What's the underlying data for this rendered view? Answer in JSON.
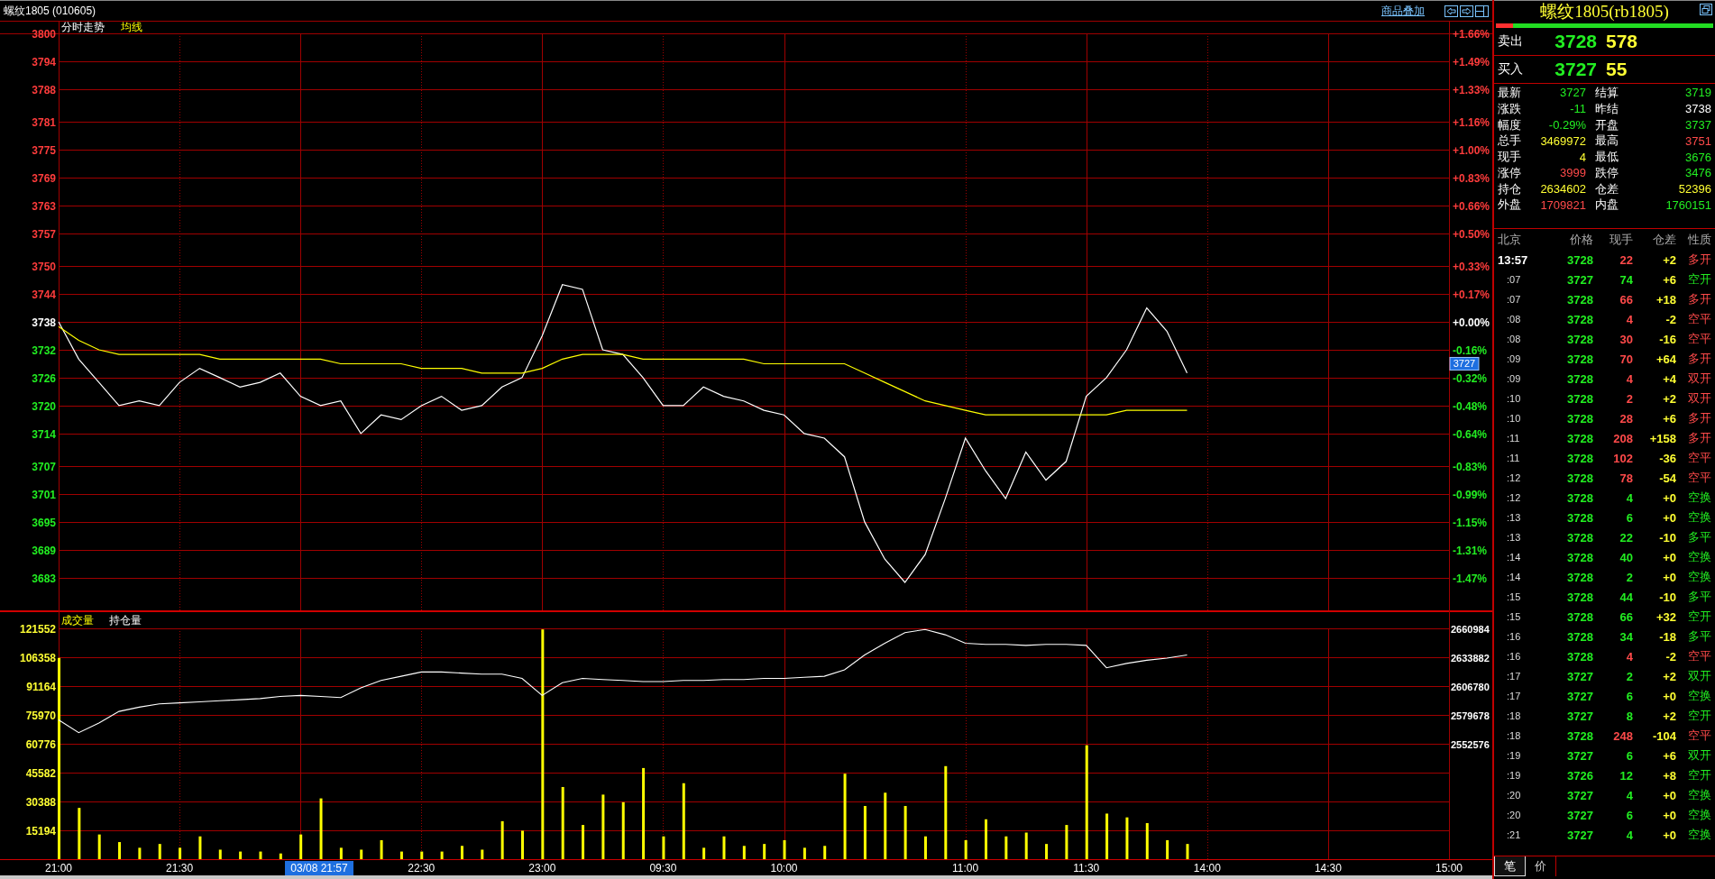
{
  "window": {
    "title": "螺纹1805 (010605)"
  },
  "toolbar": {
    "overlay_link": "商品叠加"
  },
  "price_chart": {
    "axis_labels": [
      {
        "color": "#ff3c3c"
      },
      {
        "color": "#ff3c3c"
      },
      {
        "color": "#ff3c3c"
      },
      {
        "color": "#ff3c3c"
      },
      {
        "color": "#ff3c3c"
      },
      {
        "color": "#ff3c3c"
      },
      {
        "color": "#ff3c3c"
      },
      {
        "color": "#ff3c3c"
      },
      {
        "color": "#ff3c3c"
      },
      {
        "color": "#ff3c3c"
      },
      {
        "color": "#ffffff"
      },
      {
        "color": "#22ee22"
      },
      {
        "color": "#22ee22"
      },
      {
        "color": "#22ee22"
      },
      {
        "color": "#22ee22"
      },
      {
        "color": "#22ee22"
      },
      {
        "color": "#22ee22"
      },
      {
        "color": "#22ee22"
      },
      {
        "color": "#22ee22"
      },
      {
        "color": "#22ee22"
      }
    ],
    "last_price_tag": "3727",
    "chart_data": {
      "type": "line",
      "title": "分时走势",
      "grid": true,
      "ylim": [
        3676,
        3800
      ],
      "yticks": [
        3800,
        3794,
        3788,
        3781,
        3775,
        3769,
        3763,
        3757,
        3750,
        3744,
        3738,
        3732,
        3726,
        3720,
        3714,
        3707,
        3701,
        3695,
        3689,
        3683
      ],
      "y2ticks": [
        "+1.66%",
        "+1.49%",
        "+1.33%",
        "+1.16%",
        "+1.00%",
        "+0.83%",
        "+0.66%",
        "+0.50%",
        "+0.33%",
        "+0.17%",
        "+0.00%",
        "-0.16%",
        "-0.32%",
        "-0.48%",
        "-0.64%",
        "-0.83%",
        "-0.99%",
        "-1.15%",
        "-1.31%",
        "-1.47%"
      ],
      "categories": [
        null,
        null,
        null,
        null,
        null,
        null,
        null,
        null,
        null,
        null,
        null,
        null,
        null,
        null,
        null,
        null,
        null,
        null,
        null,
        null,
        null,
        null,
        null,
        null,
        null,
        null,
        null,
        null,
        null,
        null,
        null,
        null,
        null,
        null,
        null,
        null,
        null,
        null,
        null,
        null,
        null,
        null,
        null,
        null,
        null,
        null,
        null,
        null,
        null,
        null,
        null,
        null,
        null,
        null,
        null,
        null,
        null,
        null,
        null,
        null,
        null,
        null,
        null,
        null,
        null,
        null,
        null,
        null,
        null,
        null
      ],
      "series": [
        {
          "color": "#ffffff",
          "values": [
            3738,
            3730,
            3725,
            3720,
            3721,
            3720,
            3725,
            3728,
            3726,
            3724,
            3725,
            3727,
            3722,
            3720,
            3721,
            3714,
            3718,
            3717,
            3720,
            3722,
            3719,
            3720,
            3724,
            3726,
            3735,
            3746,
            3745,
            3732,
            3731,
            3726,
            3720,
            3720,
            3724,
            3722,
            3721,
            3719,
            3718,
            3714,
            3713,
            3709,
            3695,
            3687,
            3682,
            3688,
            3700,
            3713,
            3706,
            3700,
            3710,
            3704,
            3708,
            3722,
            3726,
            3732,
            3741,
            3736,
            3727,
            null,
            null,
            null,
            null,
            null,
            null,
            null,
            null,
            null,
            null,
            null,
            null,
            null
          ]
        },
        {
          "name": "均线",
          "color": "#ffff00",
          "values": [
            3737,
            3734,
            3732,
            3731,
            3731,
            3731,
            3731,
            3731,
            3730,
            3730,
            3730,
            3730,
            3730,
            3730,
            3729,
            3729,
            3729,
            3729,
            3728,
            3728,
            3728,
            3727,
            3727,
            3727,
            3728,
            3730,
            3731,
            3731,
            3731,
            3730,
            3730,
            3730,
            3730,
            3730,
            3730,
            3729,
            3729,
            3729,
            3729,
            3729,
            3727,
            3725,
            3723,
            3721,
            3720,
            3719,
            3718,
            3718,
            3718,
            3718,
            3718,
            3718,
            3718,
            3719,
            3719,
            3719,
            3719,
            null,
            null,
            null,
            null,
            null,
            null,
            null,
            null,
            null,
            null,
            null,
            null,
            null
          ]
        }
      ]
    }
  },
  "volume_chart": {
    "cursor_label": "03/08 21:57",
    "chart_data": {
      "type": "bar",
      "grid": true,
      "ylim": [
        0,
        121552
      ],
      "yticks": [
        121552,
        106358,
        91164,
        75970,
        60776,
        45582,
        30388,
        15194
      ],
      "categories": [
        "21:00",
        null,
        null,
        null,
        null,
        null,
        "21:30",
        null,
        null,
        null,
        null,
        null,
        null,
        null,
        null,
        null,
        null,
        null,
        "22:30",
        null,
        null,
        null,
        null,
        null,
        "23:00",
        null,
        null,
        null,
        null,
        null,
        "09:30",
        null,
        null,
        null,
        null,
        null,
        "10:00",
        null,
        null,
        null,
        null,
        null,
        null,
        null,
        null,
        "11:00",
        null,
        null,
        null,
        null,
        null,
        "11:30",
        null,
        null,
        null,
        null,
        null,
        "14:00",
        null,
        null,
        null,
        null,
        null,
        "14:30",
        null,
        null,
        null,
        null,
        null,
        "15:00"
      ],
      "series": [
        {
          "name": "成交量",
          "color": "#ffff00",
          "values": [
            106000,
            27000,
            13000,
            9000,
            6000,
            8000,
            6000,
            12000,
            5000,
            4000,
            4000,
            3000,
            13000,
            32000,
            6000,
            5000,
            10000,
            4000,
            4000,
            4000,
            7000,
            5000,
            20000,
            15000,
            121000,
            38000,
            18000,
            34000,
            30000,
            48000,
            12000,
            40000,
            6000,
            12000,
            7000,
            8000,
            10000,
            6000,
            7000,
            45000,
            28000,
            35000,
            28000,
            12000,
            49000,
            10000,
            21000,
            12000,
            14000,
            8000,
            18000,
            60000,
            24000,
            22000,
            19000,
            10000,
            8000,
            null,
            null,
            null,
            null,
            null,
            null,
            null,
            null,
            null,
            null,
            null,
            null,
            null
          ]
        }
      ]
    },
    "open_interest": {
      "chart_data": {
        "type": "line",
        "ylim": [
          2552576,
          2660984
        ],
        "yticks": [
          2660984,
          2633882,
          2606780,
          2579678,
          2552576
        ],
        "categories": [
          null,
          null,
          null,
          null,
          null,
          null,
          null,
          null,
          null,
          null,
          null,
          null,
          null,
          null,
          null,
          null,
          null,
          null,
          null,
          null,
          null,
          null,
          null,
          null,
          null,
          null,
          null,
          null,
          null,
          null,
          null,
          null,
          null,
          null,
          null,
          null,
          null,
          null,
          null,
          null,
          null,
          null,
          null,
          null,
          null,
          null,
          null,
          null,
          null,
          null,
          null,
          null,
          null,
          null,
          null,
          null,
          null,
          null,
          null,
          null,
          null,
          null,
          null,
          null,
          null,
          null,
          null,
          null,
          null,
          null
        ],
        "series": [
          {
            "name": "持仓量",
            "color": "#ffffff",
            "values": [
              2575000,
              2563000,
              2572000,
              2583000,
              2587000,
              2590000,
              2591000,
              2592000,
              2593000,
              2594000,
              2595000,
              2597000,
              2598000,
              2597000,
              2596000,
              2605000,
              2612000,
              2616000,
              2620000,
              2620000,
              2619000,
              2618000,
              2618000,
              2614000,
              2598000,
              2610000,
              2614000,
              2613000,
              2612000,
              2611000,
              2611000,
              2612000,
              2612000,
              2613000,
              2613000,
              2614000,
              2614000,
              2615000,
              2616000,
              2622000,
              2636000,
              2647000,
              2657000,
              2660000,
              2655000,
              2647000,
              2646000,
              2646000,
              2645000,
              2646000,
              2646000,
              2645000,
              2624000,
              2628000,
              2631000,
              2633000,
              2636000,
              null,
              null,
              null,
              null,
              null,
              null,
              null,
              null,
              null,
              null,
              null,
              null,
              null
            ]
          }
        ]
      }
    }
  },
  "quote": {
    "title": "螺纹1805(rb1805)",
    "ratio_bar": {
      "level": 0.08
    },
    "ask": {
      "label": "卖出",
      "price": "3728",
      "volume": "578"
    },
    "bid": {
      "label": "买入",
      "price": "3727",
      "volume": "55"
    },
    "stats": [
      {
        "label": "最新",
        "value": "3727",
        "color": "#22ee22"
      },
      {
        "label": "结算",
        "value": "3719",
        "color": "#22ee22"
      },
      {
        "label": "涨跌",
        "value": "-11",
        "color": "#22ee22"
      },
      {
        "label": "昨结",
        "value": "3738",
        "color": "#ffffff"
      },
      {
        "label": "幅度",
        "value": "-0.29%",
        "color": "#22ee22"
      },
      {
        "label": "开盘",
        "value": "3737",
        "color": "#22ee22"
      },
      {
        "label": "总手",
        "value": "3469972",
        "color": "#ffff33"
      },
      {
        "label": "最高",
        "value": "3751",
        "color": "#ff4a4a"
      },
      {
        "label": "现手",
        "value": "4",
        "color": "#ffff33"
      },
      {
        "label": "最低",
        "value": "3676",
        "color": "#22ee22"
      },
      {
        "label": "涨停",
        "value": "3999",
        "color": "#ff4a4a"
      },
      {
        "label": "跌停",
        "value": "3476",
        "color": "#22ee22"
      },
      {
        "label": "持仓",
        "value": "2634602",
        "color": "#ffff33"
      },
      {
        "label": "仓差",
        "value": "52396",
        "color": "#ffff33"
      },
      {
        "label": "外盘",
        "value": "1709821",
        "color": "#ff4a4a"
      },
      {
        "label": "内盘",
        "value": "1760151",
        "color": "#22ee22"
      }
    ]
  },
  "trades": {
    "columns": [
      "北京",
      "价格",
      "现手",
      "仓差",
      "性质"
    ],
    "rows": [
      {
        "time": "13:57",
        "price": "3728",
        "volume": "22",
        "change": "+2",
        "nature": "多开",
        "active_buy": true
      },
      {
        "time": ":07",
        "price": "3727",
        "volume": "74",
        "change": "+6",
        "nature": "空开",
        "active_buy": false
      },
      {
        "time": ":07",
        "price": "3728",
        "volume": "66",
        "change": "+18",
        "nature": "多开",
        "active_buy": true
      },
      {
        "time": ":08",
        "price": "3728",
        "volume": "4",
        "change": "-2",
        "nature": "空平",
        "active_buy": true
      },
      {
        "time": ":08",
        "price": "3728",
        "volume": "30",
        "change": "-16",
        "nature": "空平",
        "active_buy": true
      },
      {
        "time": ":09",
        "price": "3728",
        "volume": "70",
        "change": "+64",
        "nature": "多开",
        "active_buy": true
      },
      {
        "time": ":09",
        "price": "3728",
        "volume": "4",
        "change": "+4",
        "nature": "双开",
        "active_buy": true
      },
      {
        "time": ":10",
        "price": "3728",
        "volume": "2",
        "change": "+2",
        "nature": "双开",
        "active_buy": true
      },
      {
        "time": ":10",
        "price": "3728",
        "volume": "28",
        "change": "+6",
        "nature": "多开",
        "active_buy": true
      },
      {
        "time": ":11",
        "price": "3728",
        "volume": "208",
        "change": "+158",
        "nature": "多开",
        "active_buy": true
      },
      {
        "time": ":11",
        "price": "3728",
        "volume": "102",
        "change": "-36",
        "nature": "空平",
        "active_buy": true
      },
      {
        "time": ":12",
        "price": "3728",
        "volume": "78",
        "change": "-54",
        "nature": "空平",
        "active_buy": true
      },
      {
        "time": ":12",
        "price": "3728",
        "volume": "4",
        "change": "+0",
        "nature": "空换",
        "active_buy": false
      },
      {
        "time": ":13",
        "price": "3728",
        "volume": "6",
        "change": "+0",
        "nature": "空换",
        "active_buy": false
      },
      {
        "time": ":13",
        "price": "3728",
        "volume": "22",
        "change": "-10",
        "nature": "多平",
        "active_buy": false
      },
      {
        "time": ":14",
        "price": "3728",
        "volume": "40",
        "change": "+0",
        "nature": "空换",
        "active_buy": false
      },
      {
        "time": ":14",
        "price": "3728",
        "volume": "2",
        "change": "+0",
        "nature": "空换",
        "active_buy": false
      },
      {
        "time": ":15",
        "price": "3728",
        "volume": "44",
        "change": "-10",
        "nature": "多平",
        "active_buy": false
      },
      {
        "time": ":15",
        "price": "3728",
        "volume": "66",
        "change": "+32",
        "nature": "空开",
        "active_buy": false
      },
      {
        "time": ":16",
        "price": "3728",
        "volume": "34",
        "change": "-18",
        "nature": "多平",
        "active_buy": false
      },
      {
        "time": ":16",
        "price": "3728",
        "volume": "4",
        "change": "-2",
        "nature": "空平",
        "active_buy": true
      },
      {
        "time": ":17",
        "price": "3727",
        "volume": "2",
        "change": "+2",
        "nature": "双开",
        "active_buy": false
      },
      {
        "time": ":17",
        "price": "3727",
        "volume": "6",
        "change": "+0",
        "nature": "空换",
        "active_buy": false
      },
      {
        "time": ":18",
        "price": "3727",
        "volume": "8",
        "change": "+2",
        "nature": "空开",
        "active_buy": false
      },
      {
        "time": ":18",
        "price": "3728",
        "volume": "248",
        "change": "-104",
        "nature": "空平",
        "active_buy": true
      },
      {
        "time": ":19",
        "price": "3727",
        "volume": "6",
        "change": "+6",
        "nature": "双开",
        "active_buy": false
      },
      {
        "time": ":19",
        "price": "3726",
        "volume": "12",
        "change": "+8",
        "nature": "空开",
        "active_buy": false
      },
      {
        "time": ":20",
        "price": "3727",
        "volume": "4",
        "change": "+0",
        "nature": "空换",
        "active_buy": false
      },
      {
        "time": ":20",
        "price": "3727",
        "volume": "6",
        "change": "+0",
        "nature": "空换",
        "active_buy": false
      },
      {
        "time": ":21",
        "price": "3727",
        "volume": "4",
        "change": "+0",
        "nature": "空换",
        "active_buy": false
      }
    ]
  },
  "bottom_tabs": [
    {
      "label": "笔",
      "selected": true
    },
    {
      "label": "价",
      "selected": false
    }
  ]
}
